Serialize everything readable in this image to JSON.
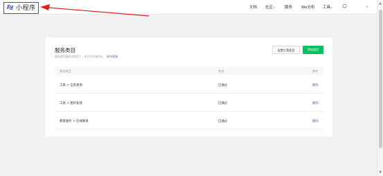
{
  "header": {
    "logo_text": "小程序",
    "nav": [
      {
        "label": "文档"
      },
      {
        "label": "社区"
      },
      {
        "label": "服务"
      },
      {
        "label": "We分析"
      },
      {
        "label": "工具"
      }
    ]
  },
  "card": {
    "title": "服务类目",
    "subtitle": "服务类目最多添加5个，本月可添加0次。",
    "subtitle_link": "联系客服",
    "btn_secondary": "设置主营类目",
    "btn_primary": "添加类目",
    "columns": [
      "服务类目",
      "状态",
      "操作"
    ],
    "rows": [
      {
        "category": "工具 > 信息查询",
        "status": "已通过",
        "action": "删除"
      },
      {
        "category": "工具 > 图片处理",
        "status": "已通过",
        "action": "删除"
      },
      {
        "category": "教育服务 > 在线教育",
        "status": "已通过",
        "action": "删除"
      }
    ]
  },
  "colors": {
    "accent": "#07c160",
    "link": "#576b95",
    "annotation": "#e02020"
  }
}
